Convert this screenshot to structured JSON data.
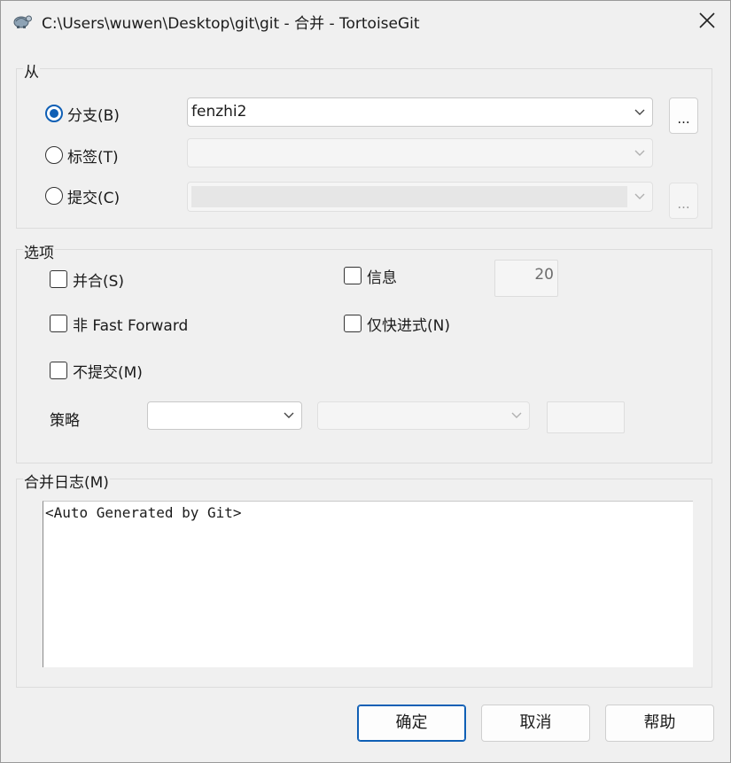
{
  "window": {
    "title": "C:\\Users\\wuwen\\Desktop\\git\\git - 合并 - TortoiseGit",
    "icon": "tortoisegit-icon"
  },
  "from_group": {
    "label": "从",
    "branch": {
      "label": "分支(B)",
      "selected": true,
      "value": "fenzhi2",
      "browse_label": "..."
    },
    "tag": {
      "label": "标签(T)",
      "selected": false,
      "value": ""
    },
    "commit": {
      "label": "提交(C)",
      "selected": false,
      "value": "",
      "browse_label": "..."
    }
  },
  "options_group": {
    "label": "选项",
    "squash": {
      "label": "并合(S)",
      "checked": false
    },
    "message": {
      "label": "信息",
      "checked": false,
      "value": "20"
    },
    "no_ff": {
      "label": "非 Fast Forward",
      "checked": false
    },
    "ff_only": {
      "label": "仅快进式(N)",
      "checked": false
    },
    "no_commit": {
      "label": "不提交(M)",
      "checked": false
    },
    "strategy": {
      "label": "策略",
      "value": "",
      "option_value": "",
      "extra_value": ""
    }
  },
  "merge_log": {
    "label": "合并日志(M)",
    "text": "<Auto Generated by Git>"
  },
  "buttons": {
    "ok": "确定",
    "cancel": "取消",
    "help": "帮助"
  },
  "colors": {
    "accent": "#0f5fb5",
    "background": "#f0f0f0"
  }
}
